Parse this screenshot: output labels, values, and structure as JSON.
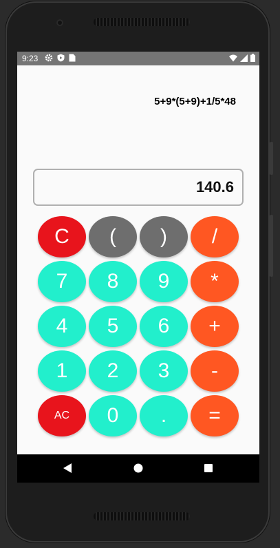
{
  "status_bar": {
    "time": "9:23",
    "left_icons": [
      "gear-icon",
      "shield-icon",
      "sim-icon"
    ],
    "right_icons": [
      "wifi-icon",
      "signal-icon",
      "battery-icon"
    ]
  },
  "display": {
    "expression": "5+9*(5+9)+1/5*48",
    "result": "140.6"
  },
  "colors": {
    "red": "#e8141c",
    "gray": "#6e6e6e",
    "orange": "#ff5722",
    "teal": "#22efcc"
  },
  "keys": [
    {
      "label": "C",
      "name": "key-clear",
      "color": "#e8141c"
    },
    {
      "label": "(",
      "name": "key-open-paren",
      "color": "#6e6e6e"
    },
    {
      "label": ")",
      "name": "key-close-paren",
      "color": "#6e6e6e"
    },
    {
      "label": "/",
      "name": "key-divide",
      "color": "#ff5722"
    },
    {
      "label": "7",
      "name": "key-7",
      "color": "#22efcc"
    },
    {
      "label": "8",
      "name": "key-8",
      "color": "#22efcc"
    },
    {
      "label": "9",
      "name": "key-9",
      "color": "#22efcc"
    },
    {
      "label": "*",
      "name": "key-multiply",
      "color": "#ff5722"
    },
    {
      "label": "4",
      "name": "key-4",
      "color": "#22efcc"
    },
    {
      "label": "5",
      "name": "key-5",
      "color": "#22efcc"
    },
    {
      "label": "6",
      "name": "key-6",
      "color": "#22efcc"
    },
    {
      "label": "+",
      "name": "key-plus",
      "color": "#ff5722"
    },
    {
      "label": "1",
      "name": "key-1",
      "color": "#22efcc"
    },
    {
      "label": "2",
      "name": "key-2",
      "color": "#22efcc"
    },
    {
      "label": "3",
      "name": "key-3",
      "color": "#22efcc"
    },
    {
      "label": "-",
      "name": "key-minus",
      "color": "#ff5722"
    },
    {
      "label": "AC",
      "name": "key-all-clear",
      "color": "#e8141c"
    },
    {
      "label": "0",
      "name": "key-0",
      "color": "#22efcc"
    },
    {
      "label": ".",
      "name": "key-decimal",
      "color": "#22efcc"
    },
    {
      "label": "=",
      "name": "key-equals",
      "color": "#ff5722"
    }
  ],
  "nav": {
    "back_icon": "back-icon",
    "home_icon": "home-icon",
    "recents_icon": "recents-icon"
  }
}
